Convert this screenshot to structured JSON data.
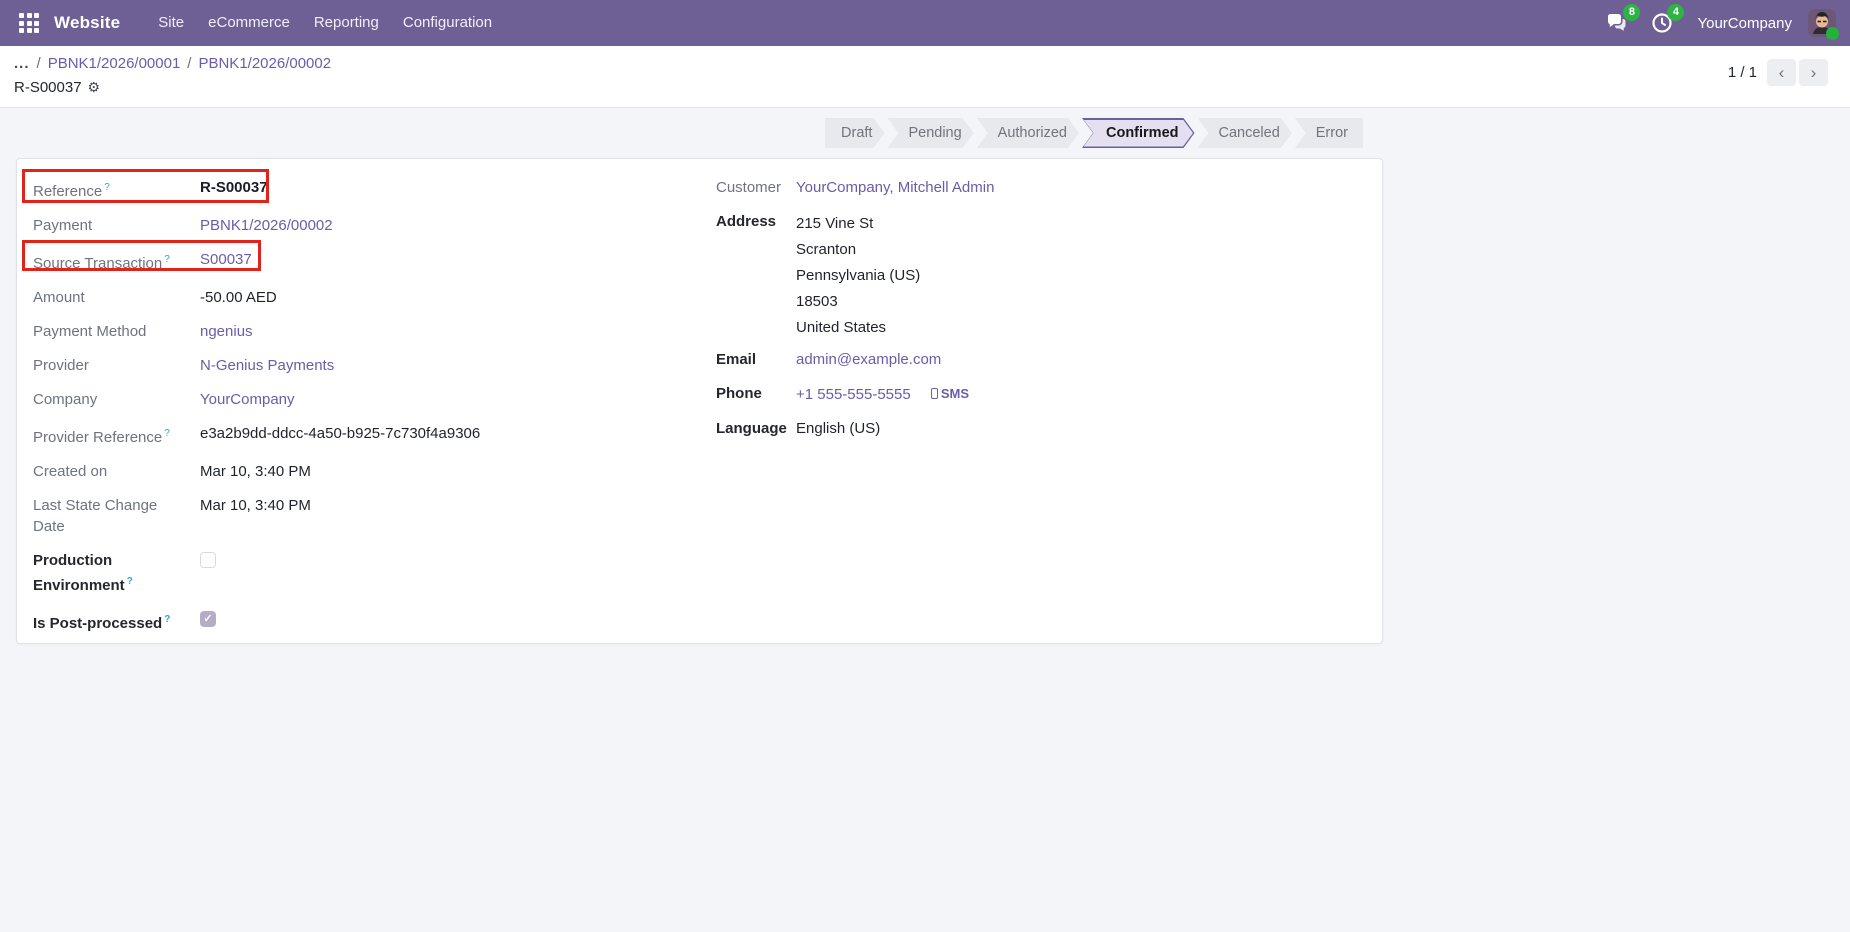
{
  "ui": {
    "help_marker": "?",
    "slash": "/",
    "ellipsis": "...",
    "gear": "⚙",
    "prev": "‹",
    "next": "›",
    "check": "✓"
  },
  "colors": {
    "navbar": "#6e6094",
    "link": "#6c5ca7",
    "highlight_red": "#e2231a",
    "badge_green": "#2fb344",
    "status_active_bg": "#e4e0ef",
    "status_active_border": "#6c5fa0"
  },
  "navbar": {
    "app_name": "Website",
    "menu_items": [
      {
        "label": "Site"
      },
      {
        "label": "eCommerce"
      },
      {
        "label": "Reporting"
      },
      {
        "label": "Configuration"
      }
    ],
    "messages_badge": "8",
    "activities_badge": "4",
    "company": "YourCompany"
  },
  "breadcrumb": {
    "items": [
      {
        "label": "PBNK1/2026/00001"
      },
      {
        "label": "PBNK1/2026/00002"
      }
    ],
    "current": "R-S00037",
    "pager_value": "1 / 1"
  },
  "statusbar": {
    "steps": [
      {
        "label": "Draft",
        "active": false
      },
      {
        "label": "Pending",
        "active": false
      },
      {
        "label": "Authorized",
        "active": false
      },
      {
        "label": "Confirmed",
        "active": true
      },
      {
        "label": "Canceled",
        "active": false
      },
      {
        "label": "Error",
        "active": false
      }
    ]
  },
  "form": {
    "left": [
      {
        "label": "Reference",
        "value": "R-S00037"
      },
      {
        "label": "Payment",
        "value": "PBNK1/2026/00002"
      },
      {
        "label": "Source Transaction",
        "value": "S00037"
      },
      {
        "label": "Amount",
        "value": "-50.00 AED"
      },
      {
        "label": "Payment Method",
        "value": "ngenius"
      },
      {
        "label": "Provider",
        "value": "N-Genius Payments"
      },
      {
        "label": "Company",
        "value": "YourCompany"
      },
      {
        "label": "Provider Reference",
        "value": "e3a2b9dd-ddcc-4a50-b925-7c730f4a9306"
      },
      {
        "label": "Created on",
        "value": "Mar 10, 3:40 PM"
      },
      {
        "label": "Last State Change Date",
        "value": "Mar 10, 3:40 PM"
      },
      {
        "label": "Production Environment",
        "checked": false
      },
      {
        "label": "Is Post-processed",
        "checked": true
      }
    ],
    "right": {
      "customer": {
        "label": "Customer",
        "value": "YourCompany, Mitchell Admin"
      },
      "address": {
        "label": "Address",
        "lines": [
          "215 Vine St",
          "Scranton",
          "Pennsylvania (US)",
          "18503",
          "United States"
        ]
      },
      "email": {
        "label": "Email",
        "value": "admin@example.com"
      },
      "phone": {
        "label": "Phone",
        "value": "+1 555-555-5555",
        "sms_label": "SMS"
      },
      "language": {
        "label": "Language",
        "value": "English (US)"
      }
    }
  }
}
